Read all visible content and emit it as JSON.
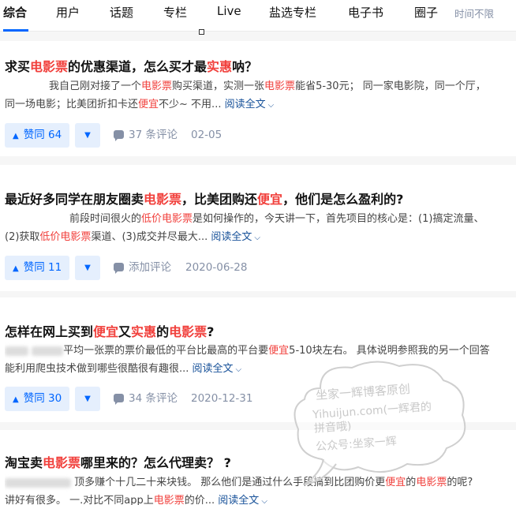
{
  "tabs": [
    {
      "label": "综合",
      "active": true
    },
    {
      "label": "用户"
    },
    {
      "label": "话题"
    },
    {
      "label": "专栏"
    },
    {
      "label": "Live"
    },
    {
      "label": "盐选专栏"
    },
    {
      "label": "电子书"
    },
    {
      "label": "圈子"
    }
  ],
  "time_filter": "时间不限",
  "read_more": "阅读全文",
  "colors": {
    "accent": "#0066ff",
    "highlight": "#f1403c",
    "link": "#175199",
    "meta": "#8590a6"
  },
  "icons": {
    "vote_up": "triangle-up-icon",
    "vote_down": "triangle-down-icon",
    "comment": "comment-bubble-icon",
    "read_more": "chevron-down-icon"
  },
  "results": [
    {
      "title": [
        {
          "t": "求买"
        },
        {
          "t": "电影票",
          "hl": true
        },
        {
          "t": "的优惠渠道，怎么买才最"
        },
        {
          "t": "实惠",
          "hl": true
        },
        {
          "t": "呐？"
        }
      ],
      "line1": [
        {
          "t": "我自己刚对接了一个"
        },
        {
          "t": "电影票",
          "hl": true
        },
        {
          "t": "购买渠道，实测一张"
        },
        {
          "t": "电影票",
          "hl": true
        },
        {
          "t": "能省5-30元； 同一家电影院，同一个厅，"
        }
      ],
      "line2": [
        {
          "t": "同一场电影；比美团折扣卡还"
        },
        {
          "t": "便宜",
          "hl": true
        },
        {
          "t": "不少~ 不用... "
        }
      ],
      "votes": "赞同 64",
      "comments": "37 条评论",
      "date": "02-05"
    },
    {
      "title": [
        {
          "t": "最近好多同学在朋友圈卖"
        },
        {
          "t": "电影票",
          "hl": true
        },
        {
          "t": "，比美团购还"
        },
        {
          "t": "便宜",
          "hl": true
        },
        {
          "t": "，他们是怎么盈利的?"
        }
      ],
      "line1": [
        {
          "t": "前段时间很火的"
        },
        {
          "t": "低价电影票",
          "hl": true
        },
        {
          "t": "是如何操作的，今天讲一下，首先项目的核心是：(1)搞定流量、"
        }
      ],
      "line2": [
        {
          "t": "(2)获取"
        },
        {
          "t": "低价电影票",
          "hl": true
        },
        {
          "t": "渠道、(3)成交并尽最大... "
        }
      ],
      "votes": "赞同 11",
      "comments": "添加评论",
      "date": "2020-06-28"
    },
    {
      "title": [
        {
          "t": "怎样在网上买到"
        },
        {
          "t": "便宜",
          "hl": true
        },
        {
          "t": "又"
        },
        {
          "t": "实惠",
          "hl": true
        },
        {
          "t": "的"
        },
        {
          "t": "电影票",
          "hl": true
        },
        {
          "t": "?"
        }
      ],
      "line1": [
        {
          "t": "平均一张票的票价最低的平台比最高的平台要"
        },
        {
          "t": "便宜",
          "hl": true
        },
        {
          "t": "5-10块左右。 具体说明参照我的另一个回答"
        }
      ],
      "line2": [
        {
          "t": "能利用爬虫技术做到哪些很酷很有趣很... "
        }
      ],
      "votes": "赞同 30",
      "comments": "34 条评论",
      "date": "2020-12-31"
    },
    {
      "title": [
        {
          "t": "淘宝卖"
        },
        {
          "t": "电影票",
          "hl": true
        },
        {
          "t": "哪里来的？怎么代理卖？ ?"
        }
      ],
      "line1": [
        {
          "t": "顶多赚个十几二十来块钱。 那么他们是通过什么手段搞到比团购价更"
        },
        {
          "t": "便宜",
          "hl": true
        },
        {
          "t": "的"
        },
        {
          "t": "电影票",
          "hl": true
        },
        {
          "t": "的呢?"
        }
      ],
      "line2": [
        {
          "t": "讲好有很多。 一.对比不同app上"
        },
        {
          "t": "电影票",
          "hl": true
        },
        {
          "t": "的价... "
        }
      ]
    }
  ],
  "watermark": {
    "line1": "坐家一辉博客原创",
    "line2": "Yihuijun.com(一辉君的",
    "line3": "拼音哦)",
    "line4": "公众号:坐家一辉"
  }
}
